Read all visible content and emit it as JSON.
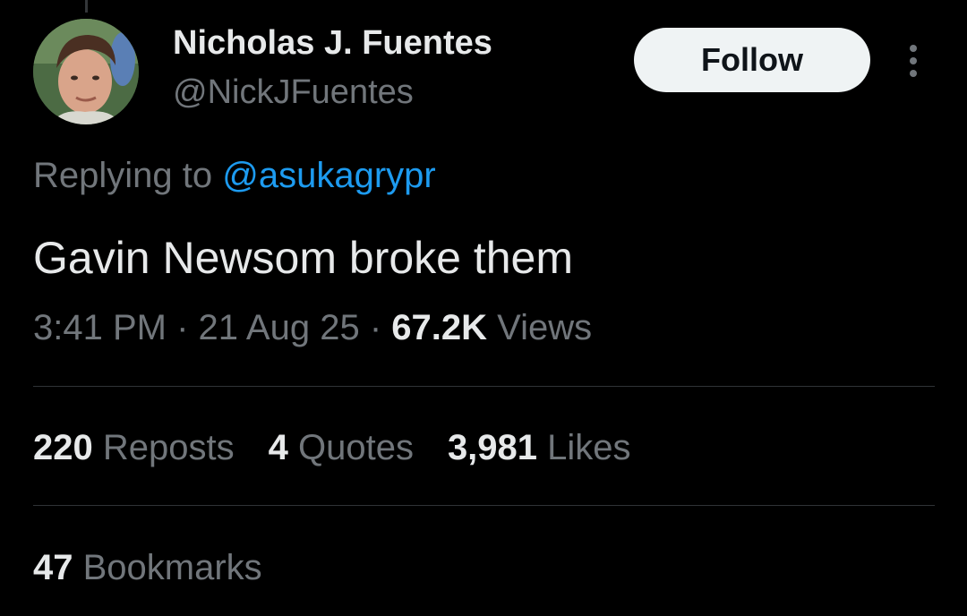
{
  "author": {
    "display_name": "Nicholas J. Fuentes",
    "handle": "@NickJFuentes",
    "avatar": "profile-photo"
  },
  "actions": {
    "follow_label": "Follow",
    "more_icon": "vertical-ellipsis-icon"
  },
  "reply": {
    "prefix": "Replying to ",
    "mention": "@asukagrypr"
  },
  "tweet": {
    "text": "Gavin Newsom broke them"
  },
  "meta": {
    "time": "3:41 PM",
    "separator1": " · ",
    "date": "21 Aug 25",
    "separator2": " · ",
    "views_count": "67.2K",
    "views_label": " Views"
  },
  "stats": {
    "reposts_count": "220",
    "reposts_label": " Reposts",
    "quotes_count": "4",
    "quotes_label": " Quotes",
    "likes_count": "3,981",
    "likes_label": " Likes",
    "bookmarks_count": "47",
    "bookmarks_label": " Bookmarks"
  },
  "colors": {
    "background": "#000000",
    "primary_text": "#e7e9ea",
    "secondary_text": "#71767b",
    "link": "#1d9bf0",
    "follow_bg": "#eff3f4",
    "divider": "#2f3336"
  }
}
